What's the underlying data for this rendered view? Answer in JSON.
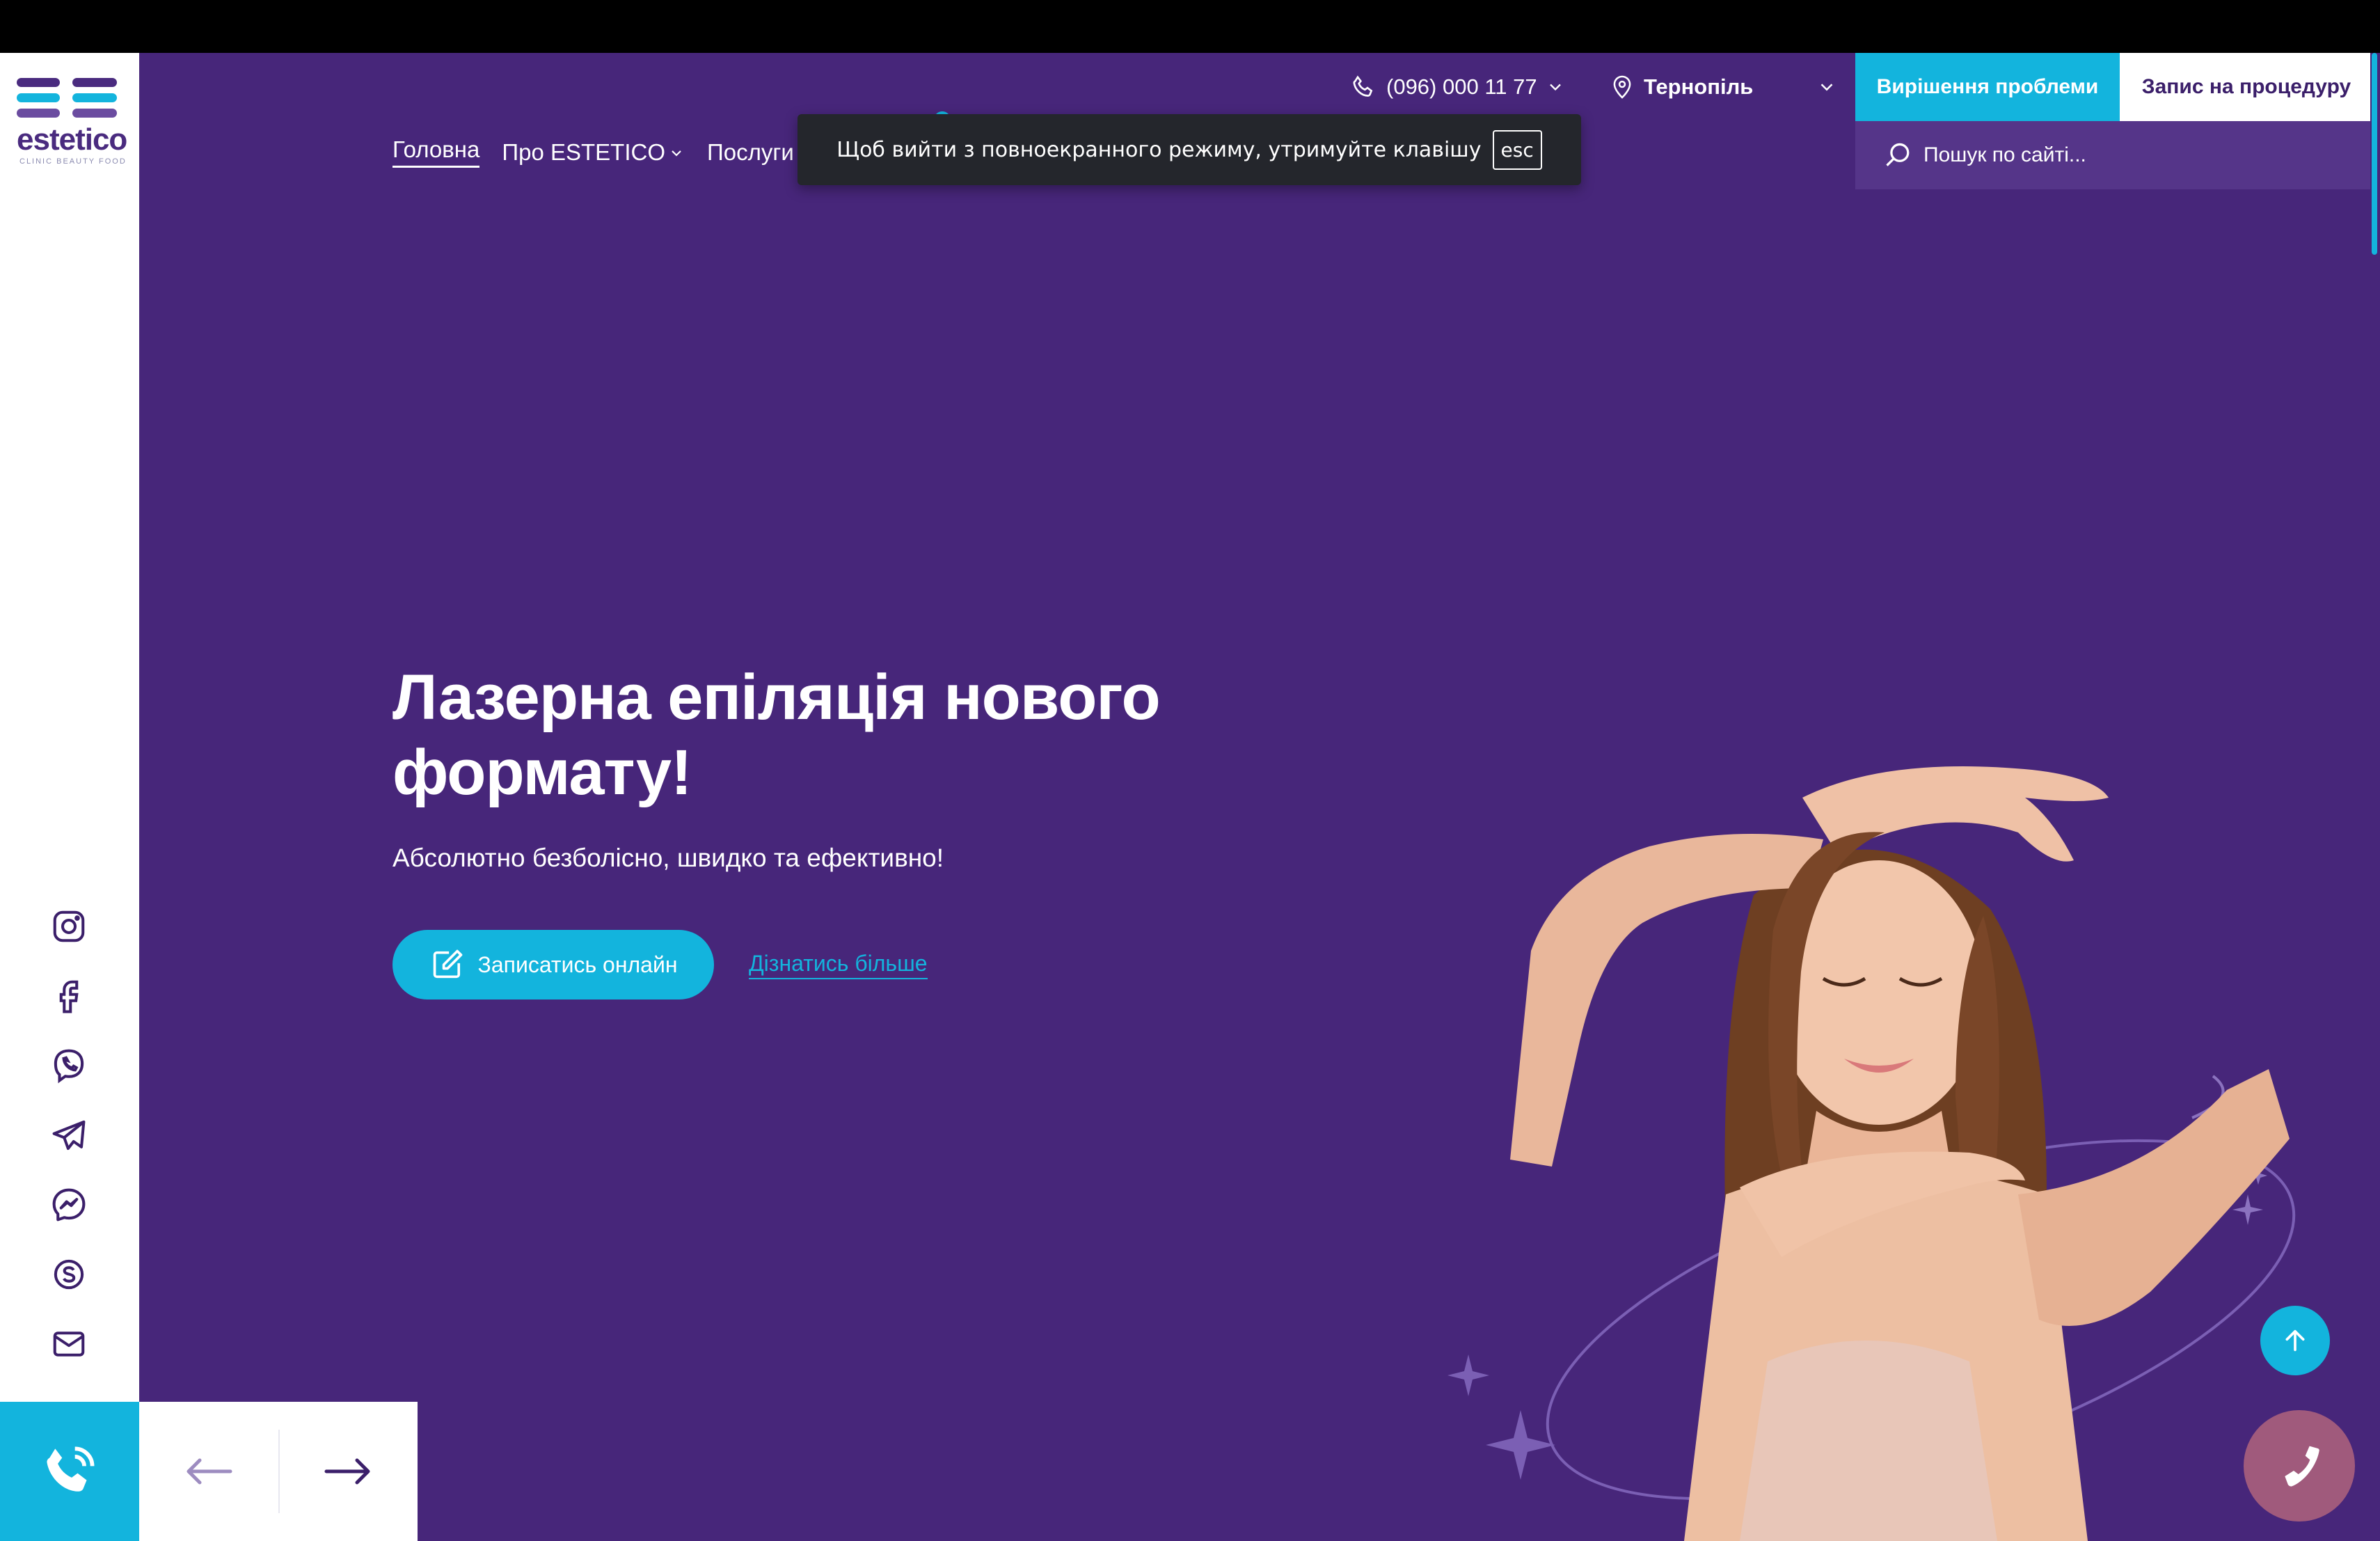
{
  "header": {
    "phone": "(096) 000 11 77",
    "city": "Тернопіль",
    "solve_label": "Вирішення проблеми",
    "book_label": "Запис на процедуру",
    "search_placeholder": "Пошук по сайті..."
  },
  "logo": {
    "word": "estetico",
    "sub": "CLINIC BEAUTY FOOD"
  },
  "nav": [
    {
      "label": "Головна",
      "active": true
    },
    {
      "label": "Про ESTETICO",
      "dropdown": true
    },
    {
      "label": "Послуги",
      "dropdown": true
    }
  ],
  "toast": {
    "message": "Щоб вийти з повноекранного режиму, утримуйте клавішу",
    "key": "esc"
  },
  "hero": {
    "title": "Лазерна епіляція нового формату!",
    "subtitle": "Абсолютно безболісно, швидко та ефективно!",
    "cta_label": "Записатись онлайн",
    "more_label": "Дізнатись більше"
  },
  "social": [
    "instagram-icon",
    "facebook-icon",
    "viber-icon",
    "telegram-icon",
    "messenger-icon",
    "skype-icon",
    "email-icon"
  ],
  "colors": {
    "primary": "#47267a",
    "accent": "#13b4dd",
    "white": "#ffffff"
  }
}
